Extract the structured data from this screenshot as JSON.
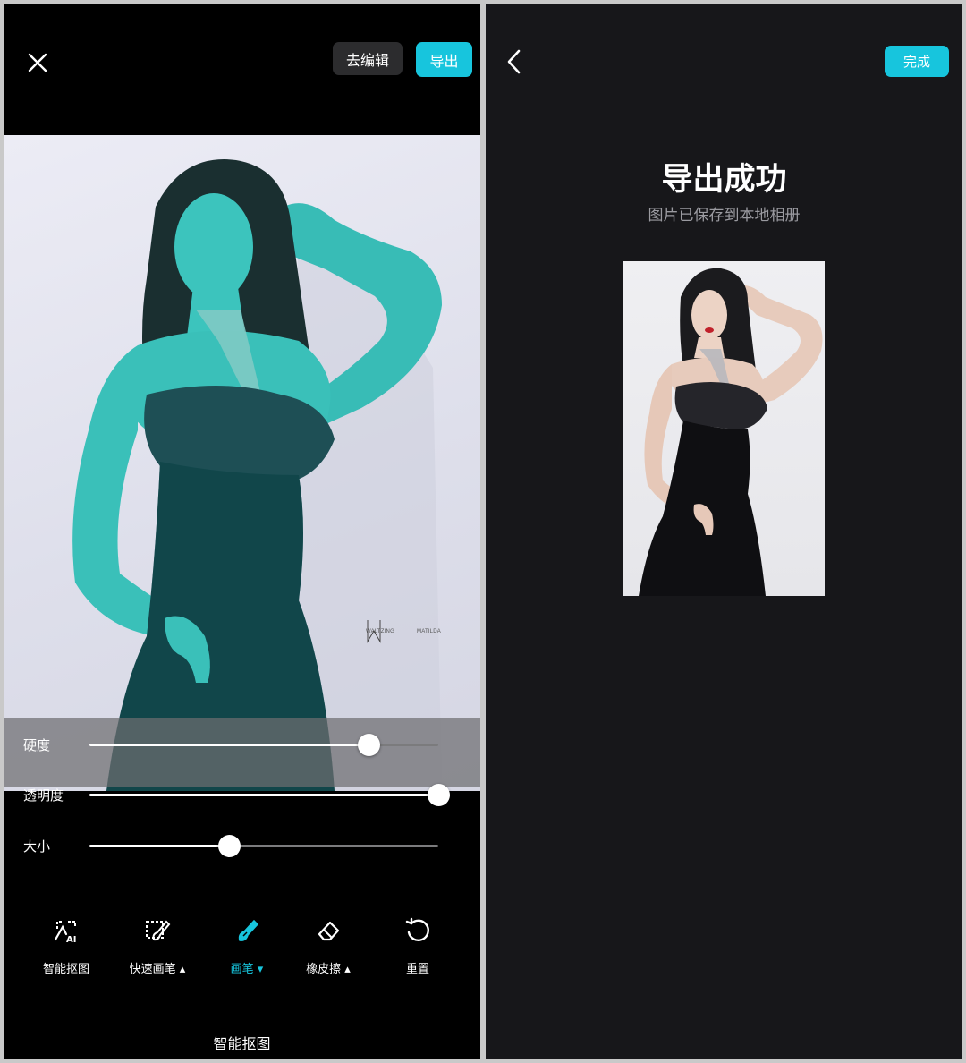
{
  "left": {
    "topbar": {
      "edit_label": "去编辑",
      "export_label": "导出"
    },
    "canvas": {
      "watermark_left": "WALTZING",
      "watermark_right": "MATILDA"
    },
    "sliders": [
      {
        "label": "硬度",
        "value": 0.8
      },
      {
        "label": "透明度",
        "value": 1.0
      },
      {
        "label": "大小",
        "value": 0.4
      }
    ],
    "tools": [
      {
        "label": "智能抠图",
        "icon": "ai-cutout-icon",
        "active": false
      },
      {
        "label": "快速画笔 ▴",
        "icon": "quick-brush-icon",
        "active": false
      },
      {
        "label": "画笔 ▾",
        "icon": "brush-icon",
        "active": true
      },
      {
        "label": "橡皮擦 ▴",
        "icon": "eraser-icon",
        "active": false
      },
      {
        "label": "重置",
        "icon": "reset-icon",
        "active": false
      }
    ],
    "mode_title": "智能抠图"
  },
  "right": {
    "done_label": "完成",
    "title": "导出成功",
    "subtitle": "图片已保存到本地相册"
  },
  "colors": {
    "accent": "#17c5dd",
    "mask": "#2fb5b0",
    "panel_dark": "#17171a"
  }
}
